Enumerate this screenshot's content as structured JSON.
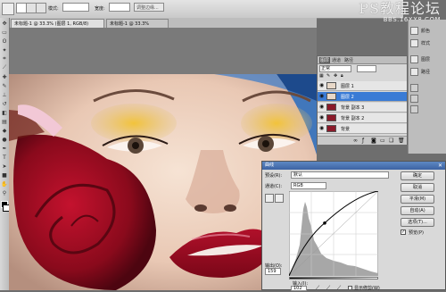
{
  "options_bar": {
    "mode_label": "模式:",
    "width_label": "宽度:",
    "refine_label": "调整边缘..."
  },
  "tabs": [
    {
      "label": "未标题-1 @ 33.3% (图层 1, RGB/8)"
    },
    {
      "label": "未标题-1 @ 33.3%"
    }
  ],
  "watermark": {
    "title": "PS教程论坛",
    "url": "BBS.16XX8.COM"
  },
  "dock": {
    "items": [
      {
        "label": "颜色"
      },
      {
        "label": "样式"
      },
      {
        "label": "图层"
      },
      {
        "label": "路径"
      }
    ]
  },
  "layers_panel": {
    "tabs": [
      "图层",
      "通道",
      "路径"
    ],
    "blend_mode": "正常",
    "layers": [
      {
        "name": "图层 1",
        "selected": false,
        "thumb": "#e8d8c8"
      },
      {
        "name": "图层 2",
        "selected": true,
        "thumb": "#e8d8c8"
      },
      {
        "name": "背景 副本 3",
        "selected": false,
        "thumb": "#8b1a2a"
      },
      {
        "name": "背景 副本 2",
        "selected": false,
        "thumb": "#8b1a2a"
      },
      {
        "name": "背景",
        "selected": false,
        "thumb": "#8b1a2a"
      }
    ]
  },
  "curves": {
    "title": "曲线",
    "preset_label": "预设(R):",
    "preset_value": "默认",
    "channel_label": "通道(C):",
    "channel_value": "RGB",
    "output_label": "输出(O):",
    "output_value": "159",
    "input_label": "输入(I):",
    "input_value": "102",
    "ok_label": "确定",
    "cancel_label": "取消",
    "smooth_label": "平滑(M)",
    "auto_label": "自动(A)",
    "options_label": "选项(T)...",
    "preview_label": "预览(P)",
    "preview_checked": true,
    "clipping_label": "显示修剪(W)",
    "point": {
      "input": 102,
      "output": 159
    }
  },
  "colors": {
    "accent": "#3a7bd5",
    "ui_gray": "#d9d9d9"
  }
}
